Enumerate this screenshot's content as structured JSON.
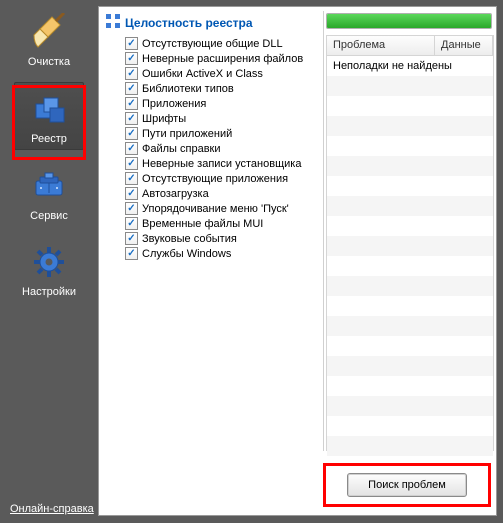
{
  "sidebar": {
    "items": [
      {
        "label": "Очистка",
        "icon": "broom-icon"
      },
      {
        "label": "Реестр",
        "icon": "registry-icon",
        "selected": true
      },
      {
        "label": "Сервис",
        "icon": "tools-icon"
      },
      {
        "label": "Настройки",
        "icon": "settings-icon"
      }
    ],
    "help": "Онлайн-справка"
  },
  "section": {
    "title": "Целостность реестра",
    "items": [
      "Отсутствующие общие DLL",
      "Неверные расширения файлов",
      "Ошибки ActiveX и Class",
      "Библиотеки типов",
      "Приложения",
      "Шрифты",
      "Пути приложений",
      "Файлы справки",
      "Неверные записи установщика",
      "Отсутствующие приложения",
      "Автозагрузка",
      "Упорядочивание меню 'Пуск'",
      "Временные файлы MUI",
      "Звуковые события",
      "Службы Windows"
    ]
  },
  "results": {
    "columns": [
      "Проблема",
      "Данные"
    ],
    "empty_message": "Неполадки не найдены"
  },
  "buttons": {
    "scan": "Поиск проблем"
  },
  "colors": {
    "accent": "#0057b3",
    "highlight": "#ff0000",
    "progress": "#2aa82a"
  }
}
